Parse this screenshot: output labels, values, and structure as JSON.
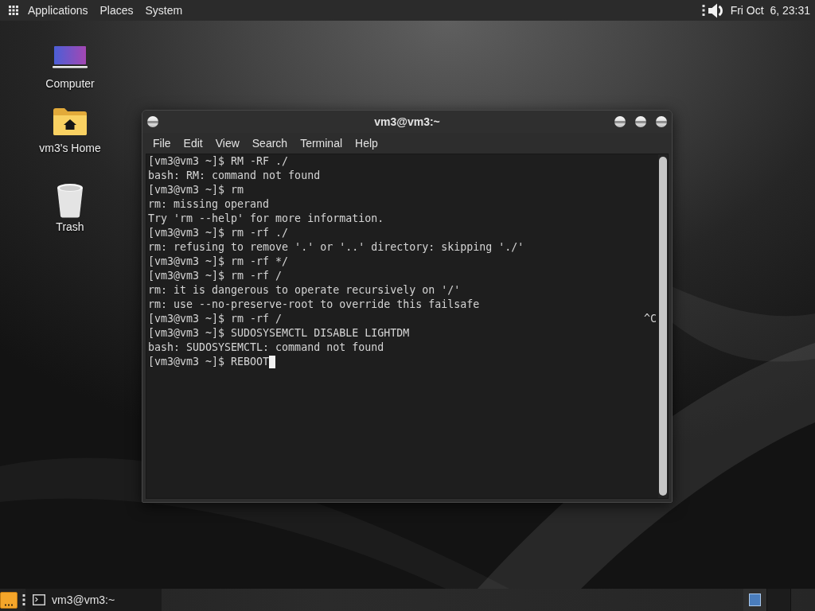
{
  "top_panel": {
    "menus": [
      "Applications",
      "Places",
      "System"
    ],
    "clock": "Fri Oct  6, 23:31"
  },
  "desktop_icons": [
    {
      "kind": "computer",
      "label": "Computer"
    },
    {
      "kind": "home",
      "label": "vm3's Home"
    },
    {
      "kind": "trash",
      "label": "Trash"
    }
  ],
  "terminal_window": {
    "title": "vm3@vm3:~",
    "menus": [
      "File",
      "Edit",
      "View",
      "Search",
      "Terminal",
      "Help"
    ],
    "lines": [
      {
        "text": "[vm3@vm3 ~]$ RM -RF ./",
        "cursor": false
      },
      {
        "text": "bash: RM: command not found",
        "cursor": false
      },
      {
        "text": "[vm3@vm3 ~]$ rm",
        "cursor": false
      },
      {
        "text": "rm: missing operand",
        "cursor": false
      },
      {
        "text": "Try 'rm --help' for more information.",
        "cursor": false
      },
      {
        "text": "[vm3@vm3 ~]$ rm -rf ./",
        "cursor": false
      },
      {
        "text": "rm: refusing to remove '.' or '..' directory: skipping './'",
        "cursor": false
      },
      {
        "text": "[vm3@vm3 ~]$ rm -rf */",
        "cursor": false
      },
      {
        "text": "[vm3@vm3 ~]$ rm -rf /",
        "cursor": false
      },
      {
        "text": "rm: it is dangerous to operate recursively on '/'",
        "cursor": false
      },
      {
        "text": "rm: use --no-preserve-root to override this failsafe",
        "cursor": false
      },
      {
        "text": "[vm3@vm3 ~]$ rm -rf /",
        "right_text": "^C",
        "cursor": false
      },
      {
        "text": "[vm3@vm3 ~]$ SUDOSYSEMCTL DISABLE LIGHTDM",
        "cursor": false
      },
      {
        "text": "bash: SUDOSYSEMCTL: command not found",
        "cursor": false
      },
      {
        "text": "[vm3@vm3 ~]$ REBOOT",
        "cursor": true
      }
    ]
  },
  "bottom_panel": {
    "windows": [
      {
        "title": "vm3@vm3:~",
        "selected": true
      }
    ],
    "workspaces": [
      {
        "selected": true,
        "has_window": true
      },
      {
        "selected": false,
        "has_window": false
      }
    ]
  }
}
